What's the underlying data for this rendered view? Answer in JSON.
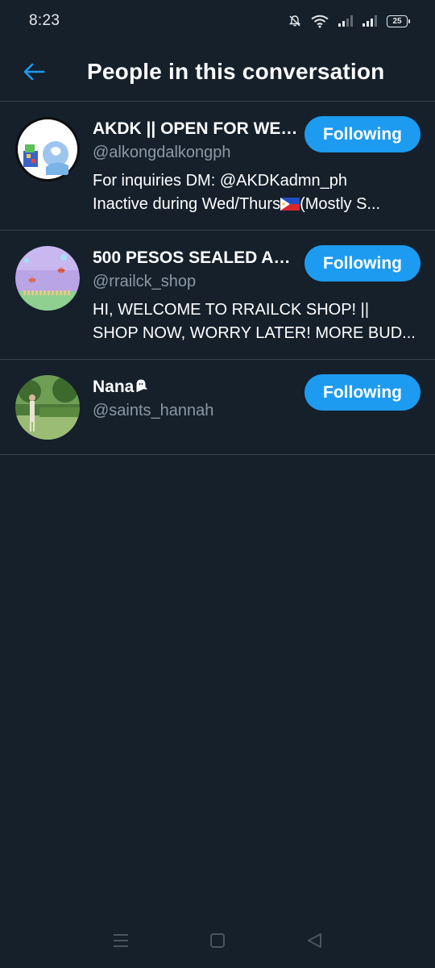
{
  "status_bar": {
    "time": "8:23",
    "battery": "25",
    "icons": [
      "mute-bell-icon",
      "wifi-icon",
      "signal-icon",
      "signal-icon"
    ]
  },
  "header": {
    "title": "People in this conversation",
    "back_icon": "back-arrow-icon"
  },
  "people": [
    {
      "name": "AKDK || OPEN FOR WEV...",
      "handle": "@alkongdalkongph",
      "bio_lines": [
        "For inquiries DM: @AKDKadmn_ph",
        "Inactive during Wed/Thurs",
        "(Mostly S..."
      ],
      "button": "Following",
      "avatar_text": "AlkongDalkong"
    },
    {
      "name": "500 PESOS SEALED AN...",
      "handle": "@rrailck_shop",
      "bio_lines": [
        "HI, WELCOME TO RRAILCK SHOP! ||",
        "SHOP NOW, WORRY LATER! MORE BUD..."
      ],
      "button": "Following",
      "avatar_text": "RRAILCK",
      "avatar_subtext": "Shop"
    },
    {
      "name": "Nana",
      "handle": "@saints_hannah",
      "bio_lines": [],
      "button": "Following"
    }
  ],
  "nav_bar": {
    "icons": [
      "recents-icon",
      "home-icon",
      "back-icon"
    ]
  },
  "colors": {
    "background": "#15202b",
    "divider": "#38444d",
    "accent": "#1d9bf0",
    "secondary_text": "#8b98a5"
  }
}
